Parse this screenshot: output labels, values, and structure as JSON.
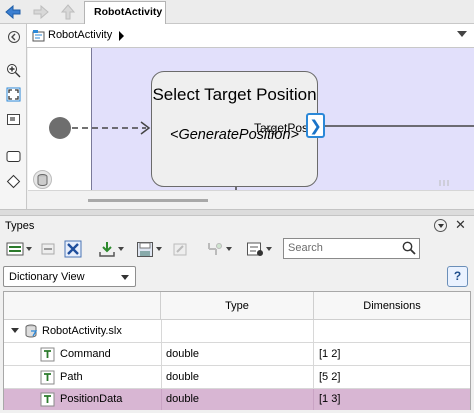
{
  "editor": {
    "tab_title": "RobotActivity",
    "breadcrumb": "RobotActivity"
  },
  "diagram": {
    "state_title": "Select Target Position",
    "state_function": "<GeneratePosition>",
    "port_label": "TargetPos"
  },
  "types_panel": {
    "title": "Types",
    "search_placeholder": "Search",
    "view_select": "Dictionary View",
    "help_label": "?",
    "columns": [
      "",
      "Type",
      "Dimensions"
    ],
    "file_row": "RobotActivity.slx",
    "rows": [
      {
        "name": "Command",
        "type": "double",
        "dimensions": "[1 2]"
      },
      {
        "name": "Path",
        "type": "double",
        "dimensions": "[5 2]"
      },
      {
        "name": "PositionData",
        "type": "double",
        "dimensions": "[1 3]"
      }
    ]
  },
  "colors": {
    "canvas_band": "#e2e0fb",
    "selected_row": "#d8b6d3",
    "port_accent": "#2b88d8"
  }
}
